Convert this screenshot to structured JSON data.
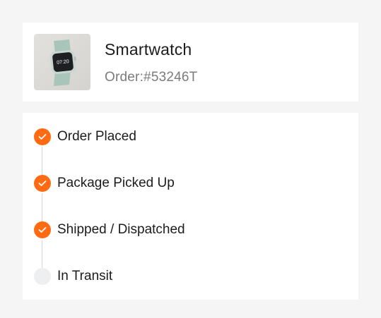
{
  "product": {
    "name": "Smartwatch",
    "order_id": "Order:#53246T",
    "image_icon": "smartwatch-image"
  },
  "timeline": {
    "accent_color": "#ff6a13",
    "pending_color": "#eeeff1",
    "steps": [
      {
        "label": "Order Placed",
        "status": "done",
        "icon": "check-icon"
      },
      {
        "label": "Package Picked Up",
        "status": "done",
        "icon": "check-icon"
      },
      {
        "label": "Shipped / Dispatched",
        "status": "done",
        "icon": "check-icon"
      },
      {
        "label": "In Transit",
        "status": "pending",
        "icon": "empty-circle"
      }
    ]
  }
}
